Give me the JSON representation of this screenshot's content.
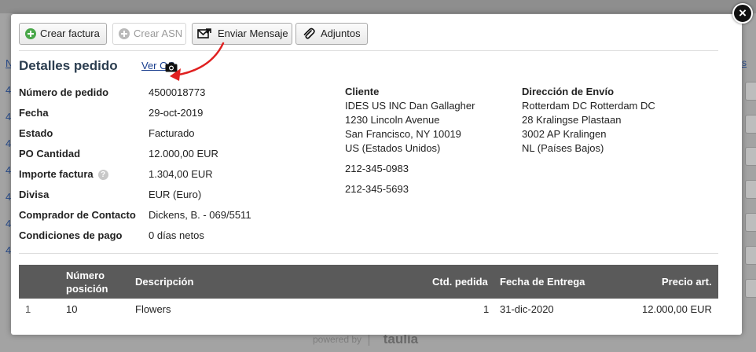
{
  "background": {
    "left_marks": [
      "N",
      "4",
      "4",
      "4",
      "4",
      "4",
      "4",
      "4"
    ],
    "right_link": "s",
    "powered_by": "powered by",
    "brand": "taulia"
  },
  "toolbar": {
    "create_invoice": "Crear factura",
    "create_asn": "Crear ASN",
    "send_message": "Enviar Mensaje",
    "attachments": "Adjuntos"
  },
  "header": {
    "title": "Detalles pedido",
    "view_po_link": "Ver OC"
  },
  "details": [
    {
      "label": "Número de pedido",
      "value": "4500018773"
    },
    {
      "label": "Fecha",
      "value": "29-oct-2019"
    },
    {
      "label": "Estado",
      "value": "Facturado"
    },
    {
      "label": "PO Cantidad",
      "value": "12.000,00 EUR"
    },
    {
      "label": "Importe factura",
      "value": "1.304,00 EUR"
    },
    {
      "label": "Divisa",
      "value": "EUR (Euro)"
    },
    {
      "label": "Comprador de Contacto",
      "value": "Dickens, B. - 069/5511"
    },
    {
      "label": "Condiciones de pago",
      "value": "0 días netos"
    }
  ],
  "customer": {
    "heading": "Cliente",
    "lines": [
      "IDES US INC Dan Gallagher",
      "1230 Lincoln Avenue",
      "San Francisco, NY 10019",
      "US (Estados Unidos)"
    ],
    "phones": [
      "212-345-0983",
      "212-345-5693"
    ]
  },
  "shipping": {
    "heading": "Dirección de Envío",
    "lines": [
      "Rotterdam DC Rotterdam DC",
      "28 Kralingse Plastaan",
      "3002 AP Kralingen",
      "NL (Países Bajos)"
    ]
  },
  "table": {
    "columns": {
      "position": "Número posición",
      "description": "Descripción",
      "qty": "Ctd. pedida",
      "delivery_date": "Fecha de Entrega",
      "price": "Precio art."
    },
    "rows": [
      {
        "index": "1",
        "position": "10",
        "description": "Flowers",
        "qty": "1",
        "delivery_date": "31-dic-2020",
        "price": "12.000,00 EUR"
      }
    ]
  },
  "colors": {
    "title": "#2c3e50",
    "link": "#1a3f8f",
    "table_header": "#5a5a5a",
    "annotation_arrow": "#e02020",
    "create_icon": "#4aa84a"
  }
}
